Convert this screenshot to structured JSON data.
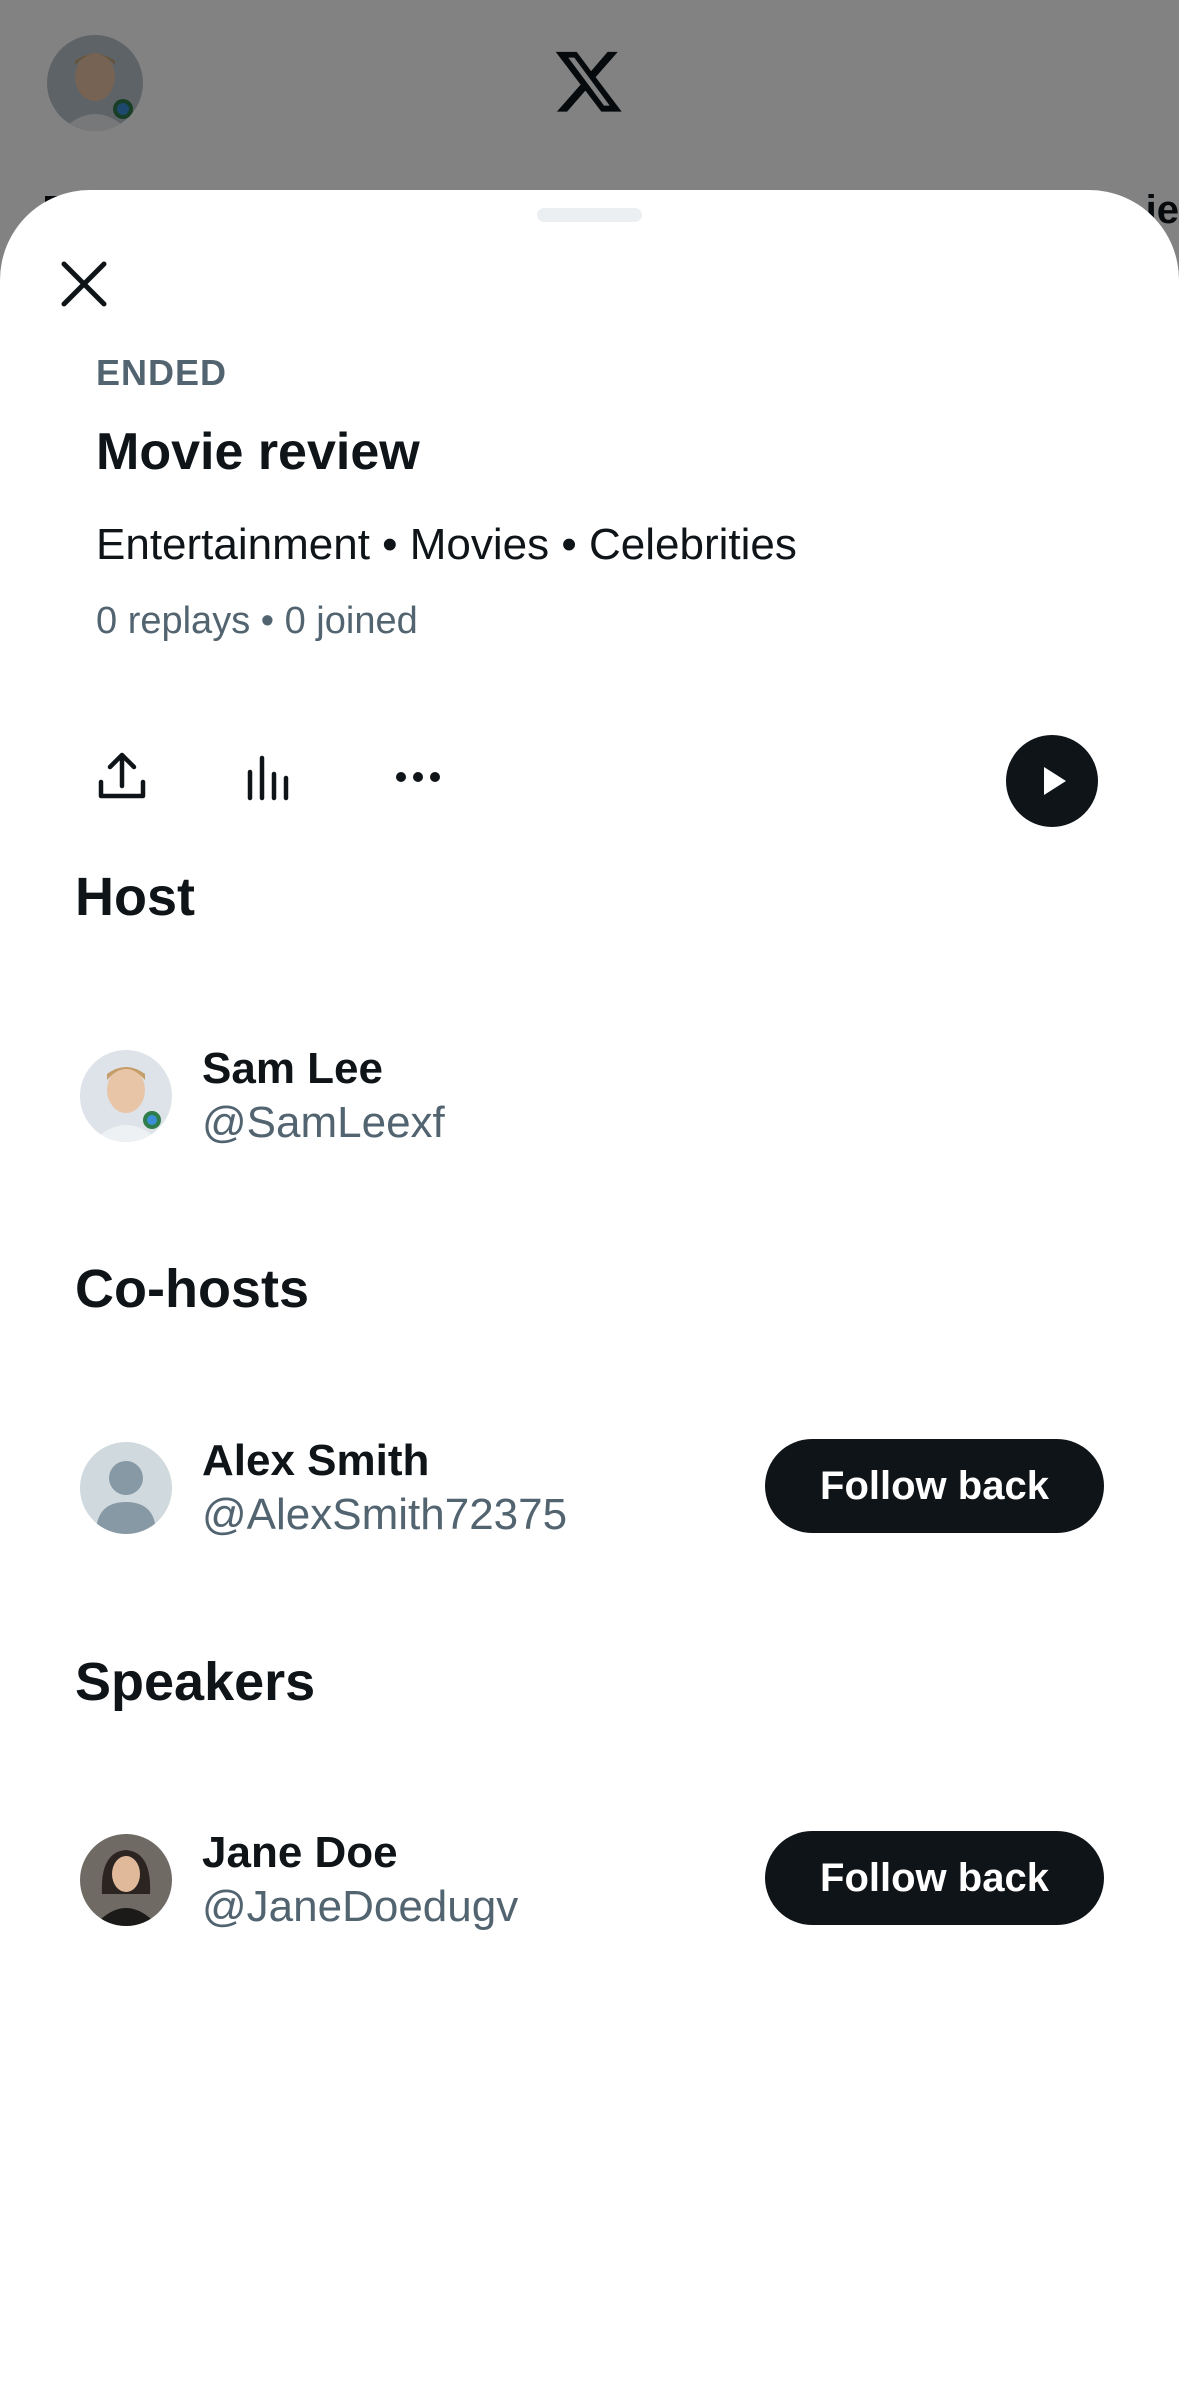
{
  "background_app": {
    "logo_icon": "x-logo-icon",
    "right_stub_text": "ie"
  },
  "space": {
    "status": "ENDED",
    "title": "Movie review",
    "topics": "Entertainment • Movies • Celebrities",
    "stats": "0 replays • 0 joined"
  },
  "actions": {
    "icons": [
      "share-icon",
      "analytics-icon",
      "more-icon",
      "play-icon"
    ]
  },
  "sections": {
    "host": {
      "title": "Host",
      "name": "Sam Lee",
      "handle": "@SamLeexf"
    },
    "cohosts": {
      "title": "Co-hosts",
      "name": "Alex Smith",
      "handle": "@AlexSmith72375",
      "button": "Follow back"
    },
    "speakers": {
      "title": "Speakers",
      "name": "Jane Doe",
      "handle": "@JaneDoedugv",
      "button": "Follow back"
    }
  },
  "colors": {
    "text_primary": "#0f1419",
    "text_secondary": "#536471",
    "button_bg": "#0f1419",
    "button_text": "#ffffff",
    "default_avatar_bg": "#cfd9de",
    "default_avatar_fg": "#8899a6"
  }
}
